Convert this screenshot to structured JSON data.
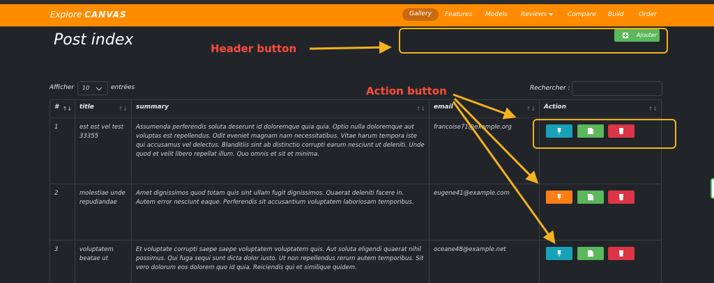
{
  "navbar": {
    "brand_prefix": "Explore",
    "brand_name": "CANVAS",
    "items": [
      {
        "label": "Gallery",
        "active": true
      },
      {
        "label": "Features"
      },
      {
        "label": "Models"
      },
      {
        "label": "Reviews",
        "dropdown": true
      },
      {
        "label": "Compare"
      },
      {
        "label": "Build"
      },
      {
        "label": "Order"
      }
    ]
  },
  "page": {
    "title": "Post index",
    "add_button_label": "Ajouter"
  },
  "annotations": {
    "header_button": "Header button",
    "action_button": "Action button"
  },
  "datatable": {
    "show_label": "Afficher",
    "page_size": "10",
    "entries_label": "entrées",
    "search_label": "Rechercher :",
    "search_value": "",
    "columns": [
      "#",
      "title",
      "summary",
      "email",
      "Action"
    ],
    "rows": [
      {
        "id": "1",
        "title": "est est vel test 33355",
        "summary": "Assumenda perferendis soluta deserunt id doloremque quia quia. Optio nulla doloremque aut voluptas est repellendus. Odit eveniet magnam nam necessitatibus. Vitae harum tempora iste qui accusamus vel delectus. Blanditiis sint ab distinctio corrupti earum nesciunt ut deleniti. Unde quod et velit libero repellat illum. Quo omnis et sit et minima.",
        "email": "francoise71@example.org",
        "pin_style": "info"
      },
      {
        "id": "2",
        "title": "molestiae unde repudiandae",
        "summary": "Amet dignissimos quod totam quis sint ullam fugit dignissimos. Quaerat deleniti facere in. Autem error nesciunt eaque. Perferendis sit accusantium voluptatem laboriosam temporibus.",
        "email": "eugene41@example.com",
        "pin_style": "warning"
      },
      {
        "id": "3",
        "title": "voluptatem beatae ut",
        "summary": "Et voluptate corrupti saepe saepe voluptatem voluptatem quis. Aut soluta eligendi quaerat nihil possimus. Qui fuga sequi sunt dicta dolor iusto. Ut non repellendus rerum autem temporibus. Sit vero dolorum eos dolorem quo id quia. Reiciendis qui et similique quidem.",
        "email": "oceane48@example.net",
        "pin_style": "info"
      }
    ]
  },
  "colors": {
    "navbar": "#ff8c00",
    "background": "#212529",
    "annotation": "#f3b21f",
    "annotation_text": "#ff4b3a",
    "btn_info": "#17a2b8",
    "btn_warning": "#fd7e14",
    "btn_success": "#5cb85c",
    "btn_danger": "#dc3545"
  },
  "icons": {
    "pin": "pin-icon",
    "edit": "edit-icon",
    "delete": "trash-icon",
    "add": "plus-square-icon"
  }
}
